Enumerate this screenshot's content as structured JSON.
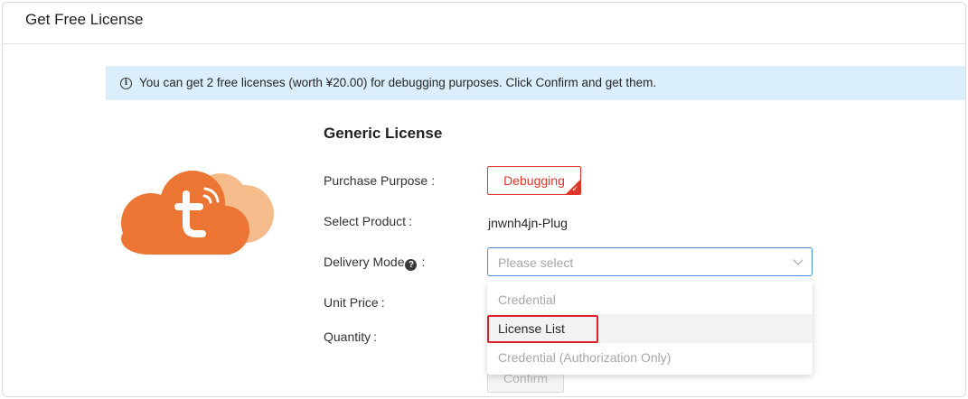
{
  "header": {
    "title": "Get Free License"
  },
  "banner": {
    "icon": "info-icon",
    "text": "You can get 2 free licenses (worth ¥20.00) for debugging purposes. Click Confirm and get them."
  },
  "form": {
    "title": "Generic License",
    "purchase_purpose_label": "Purchase Purpose",
    "purchase_purpose_value": "Debugging",
    "select_product_label": "Select Product",
    "select_product_value": "jnwnh4jn-Plug",
    "delivery_mode_label": "Delivery Mode",
    "delivery_mode_placeholder": "Please select",
    "unit_price_label": "Unit Price",
    "quantity_label": "Quantity",
    "colon": ":",
    "confirm_label": "Confirm"
  },
  "dropdown": {
    "options": [
      "Credential",
      "License List",
      "Credential (Authorization Only)"
    ],
    "hovered_index": 1
  },
  "colors": {
    "accent_red": "#e0352b",
    "banner_bg": "#daeefb",
    "focus_blue": "#4b8fd8",
    "logo_orange": "#ed7534",
    "logo_light_orange": "#f6bb8a"
  }
}
